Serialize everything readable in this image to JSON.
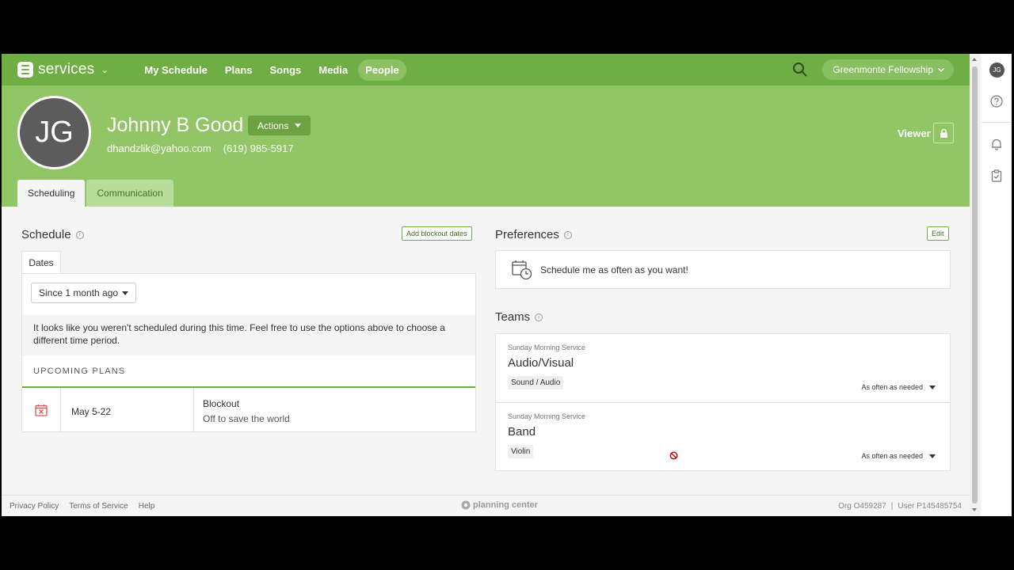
{
  "nav": {
    "brand": "services",
    "links": [
      "My Schedule",
      "Plans",
      "Songs",
      "Media",
      "People"
    ],
    "active": "People",
    "org": "Greenmonte Fellowship"
  },
  "profile": {
    "initials": "JG",
    "name": "Johnny B Good",
    "actions_label": "Actions",
    "email": "dhandzlik@yahoo.com",
    "phone": "(619) 985-5917",
    "role": "Viewer"
  },
  "tabs": [
    "Scheduling",
    "Communication"
  ],
  "schedule": {
    "title": "Schedule",
    "add_blockout_label": "Add blockout dates",
    "dates_tab": "Dates",
    "range": "Since 1 month ago",
    "empty_message": "It looks like you weren't scheduled during this time. Feel free to use the options above to choose a different time period.",
    "upcoming_label": "UPCOMING PLANS",
    "plans": [
      {
        "date": "May 5-22",
        "title": "Blockout",
        "subtitle": "Off to save the world"
      }
    ]
  },
  "preferences": {
    "title": "Preferences",
    "edit_label": "Edit",
    "text": "Schedule me as often as you want!"
  },
  "teams": {
    "title": "Teams",
    "items": [
      {
        "service": "Sunday Morning Service",
        "name": "Audio/Visual",
        "position": "Sound / Audio",
        "frequency": "As often as needed"
      },
      {
        "service": "Sunday Morning Service",
        "name": "Band",
        "position": "Violin",
        "frequency": "As often as needed"
      }
    ]
  },
  "footer": {
    "links": [
      "Privacy Policy",
      "Terms of Service",
      "Help"
    ],
    "logo": "planning center",
    "org_id": "Org O459287",
    "user_id": "User P145485754"
  },
  "rail": {
    "initials": "JG"
  },
  "colors": {
    "brand_green": "#6fae44",
    "header_green": "#91c565",
    "danger": "#d9534f"
  }
}
